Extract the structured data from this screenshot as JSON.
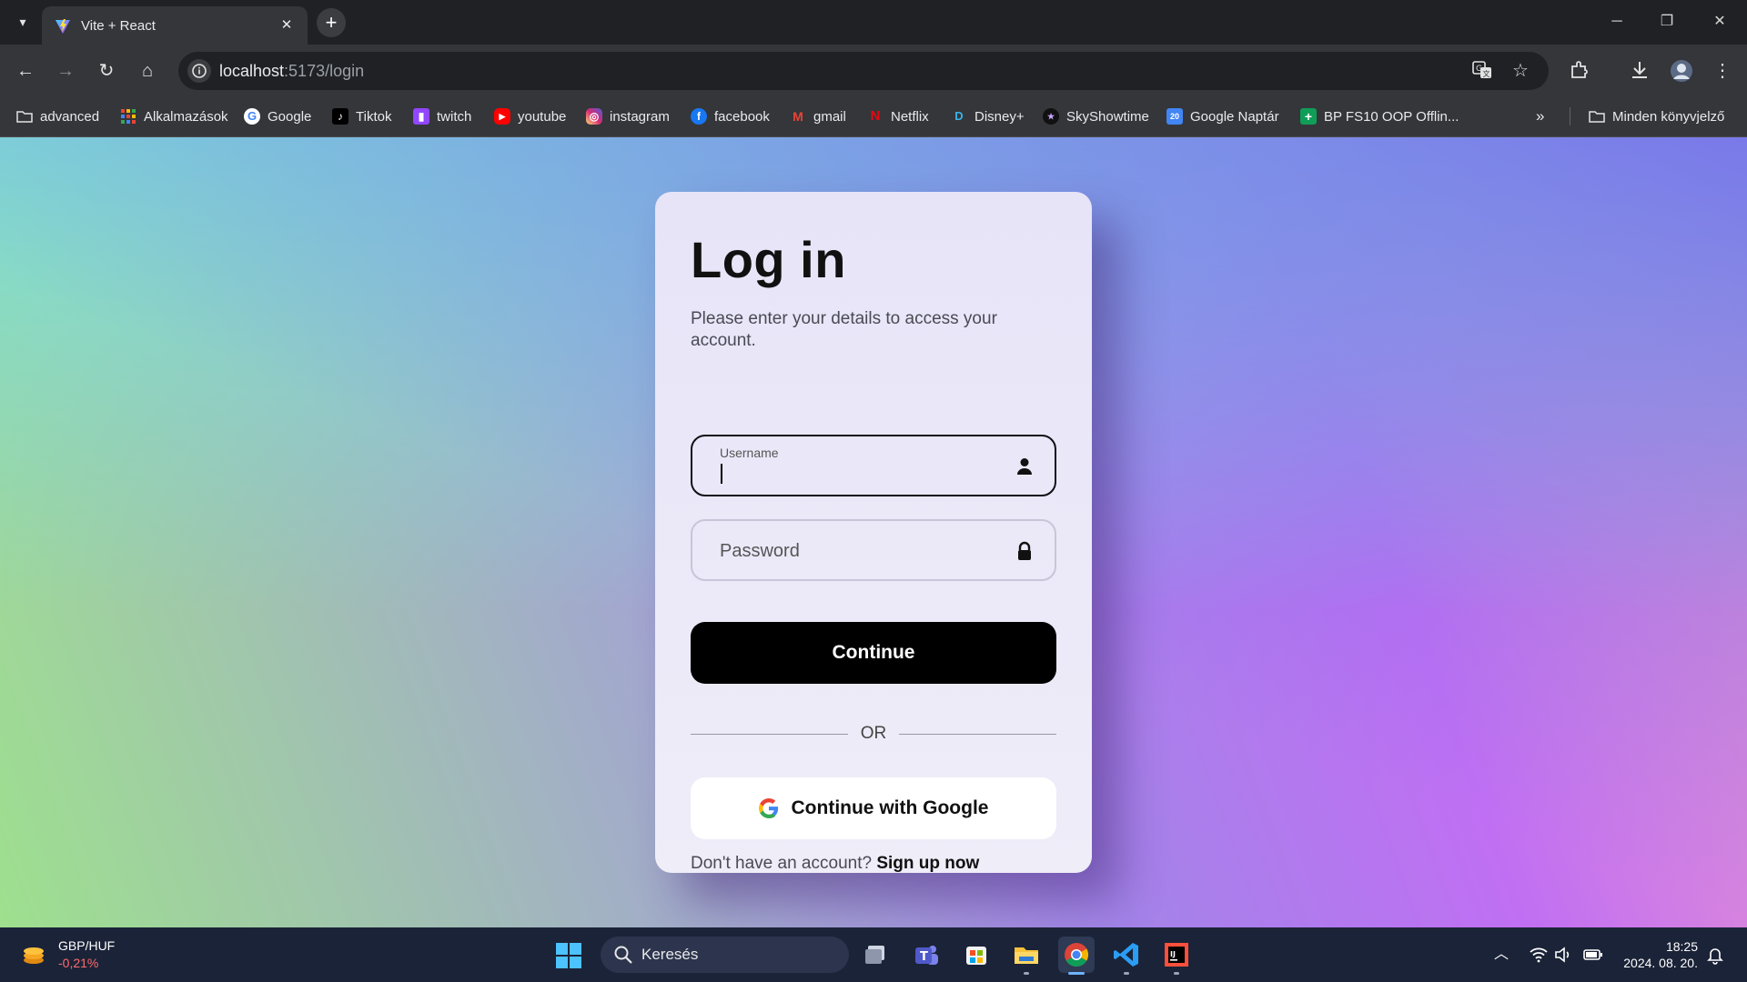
{
  "browser": {
    "tab_title": "Vite + React",
    "url_host": "localhost",
    "url_path": ":5173/login",
    "bookmarks": [
      {
        "label": "advanced",
        "icon": "folder-icon"
      },
      {
        "label": "Alkalmazások",
        "icon": "apps-grid-icon"
      },
      {
        "label": "Google",
        "icon": "google-icon"
      },
      {
        "label": "Tiktok",
        "icon": "tiktok-icon"
      },
      {
        "label": "twitch",
        "icon": "twitch-icon"
      },
      {
        "label": "youtube",
        "icon": "youtube-icon"
      },
      {
        "label": "instagram",
        "icon": "instagram-icon"
      },
      {
        "label": "facebook",
        "icon": "facebook-icon"
      },
      {
        "label": "gmail",
        "icon": "gmail-icon"
      },
      {
        "label": "Netflix",
        "icon": "netflix-icon"
      },
      {
        "label": "Disney+",
        "icon": "disney-icon"
      },
      {
        "label": "SkyShowtime",
        "icon": "skyshowtime-icon"
      },
      {
        "label": "Google Naptár",
        "icon": "calendar-icon"
      },
      {
        "label": "BP FS10 OOP Offlin...",
        "icon": "sheets-icon"
      }
    ],
    "all_bookmarks_label": "Minden könyvjelző"
  },
  "login": {
    "title": "Log in",
    "subtitle": "Please enter your details to access your account.",
    "username_label": "Username",
    "password_placeholder": "Password",
    "continue_label": "Continue",
    "or_label": "OR",
    "google_label": "Continue with Google",
    "signup_prompt": "Don't have an account?",
    "signup_link": "Sign up now"
  },
  "taskbar": {
    "widget_pair": "GBP/HUF",
    "widget_change": "-0,21%",
    "search_placeholder": "Keresés",
    "time": "18:25",
    "date": "2024. 08. 20."
  },
  "colors": {
    "card_bg": "#ece9f8",
    "button_primary": "#000000",
    "accent_gradient": [
      "#9ee08e",
      "#7ee4dd",
      "#8070ee",
      "#c06ff3",
      "#f29cc7"
    ]
  }
}
